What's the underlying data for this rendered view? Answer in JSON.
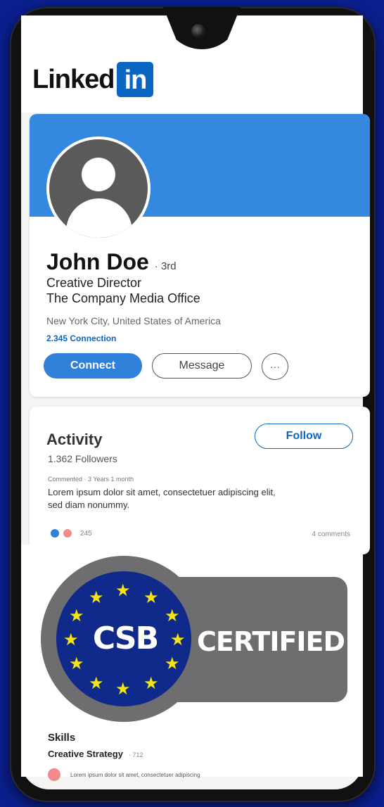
{
  "app": {
    "logo_text": "Linked",
    "logo_badge": "in"
  },
  "profile": {
    "name": "John Doe",
    "degree": "· 3rd",
    "title": "Creative Director",
    "company": "The Company Media Office",
    "location": "New York City, United States of America",
    "connections": "2.345 Connection",
    "connect_label": "Connect",
    "message_label": "Message",
    "more_label": "···"
  },
  "activity": {
    "title": "Activity",
    "followers": "1.362 Followers",
    "follow_label": "Follow",
    "post_meta": "Commented · 3 Years 1 month",
    "post_line1": "Lorem ipsum dolor sit amet, consectetuer adipiscing elit,",
    "post_line2": "sed diam nonummy.",
    "reaction_count": "245",
    "comments": "4 comments"
  },
  "badge": {
    "logo": "CSB",
    "label": "CERTIFIED",
    "colors": {
      "gray": "#6e6e70",
      "blue": "#0f2a8a",
      "star": "#f5e60a"
    }
  },
  "skills": {
    "title": "Skills",
    "skill_name": "Creative Strategy",
    "skill_count": "· 712",
    "endorse_text": "Lorem ipsum dolor sit amet, consectetuer adipiscing"
  },
  "colors": {
    "background": "#0b1f8f",
    "linkedin_blue": "#0a66c2",
    "cover": "#3588e0"
  }
}
